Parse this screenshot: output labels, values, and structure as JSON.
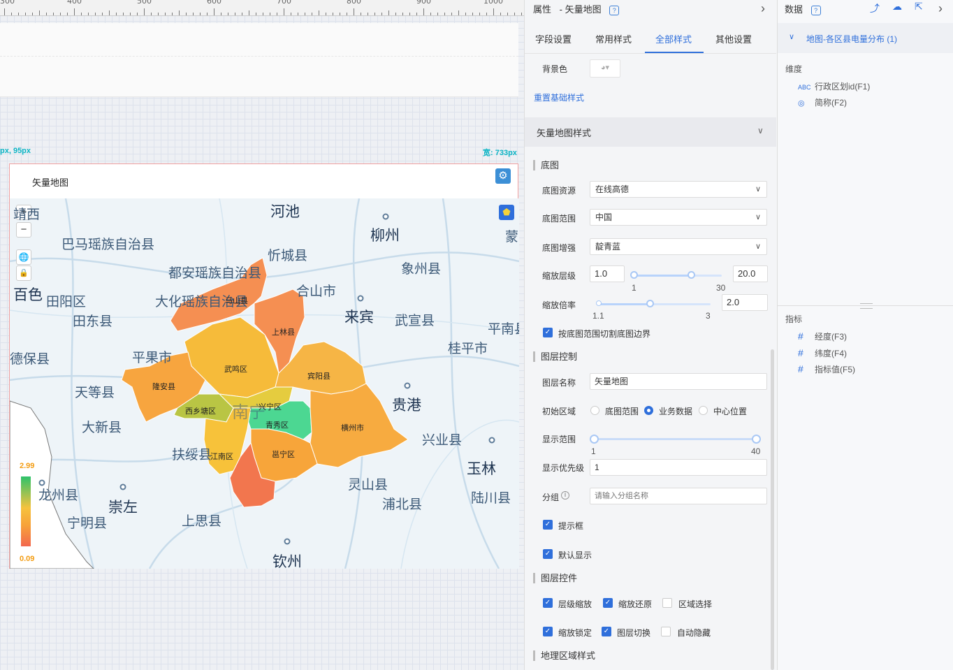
{
  "ruler": {
    "labels": [
      "300",
      "400",
      "500",
      "600",
      "700",
      "800",
      "900",
      "1000"
    ]
  },
  "guides": {
    "position": "px, 95px",
    "width": "宽: 733px"
  },
  "widget": {
    "title": "矢量地图",
    "zoom_in": "+",
    "zoom_out": "−",
    "cities": [
      "河池",
      "柳州",
      "巴马瑶族自治县",
      "忻城县",
      "象州县",
      "都安瑶族自治县",
      "百色",
      "田阳区",
      "大化瑶族自治县",
      "合山市",
      "来宾",
      "武宣县",
      "田东县",
      "平南县",
      "桂平市",
      "德保县",
      "平果市",
      "天等县",
      "贵港",
      "大新县",
      "扶绥县",
      "兴业县",
      "玉林",
      "龙州县",
      "崇左",
      "灵山县",
      "宁明县",
      "上思县",
      "浦北县",
      "陆川县",
      "钦州",
      "南宁",
      "蒙",
      "靖西"
    ],
    "regions": [
      "马山县",
      "上林县",
      "武鸣区",
      "宾阳县",
      "隆安县",
      "西乡塘区",
      "兴宁区",
      "青秀区",
      "横州市",
      "江南区",
      "邕宁区"
    ],
    "legend": {
      "max": "2.99",
      "min": "0.09"
    },
    "colors": {
      "high": "#2ec26b",
      "mid": "#f6c23e",
      "low": "#f2674e"
    }
  },
  "props": {
    "title": "属性",
    "subtitle": "- 矢量地图",
    "tabs": [
      "字段设置",
      "常用样式",
      "全部样式",
      "其他设置"
    ],
    "active_tab": "全部样式",
    "bg_label": "背景色",
    "reset_link": "重置基础样式",
    "section_title": "矢量地图样式",
    "basemap": "底图",
    "basemap_source_label": "底图资源",
    "basemap_source": "在线高德",
    "basemap_range_label": "底图范围",
    "basemap_range": "中国",
    "basemap_enhance_label": "底图增强",
    "basemap_enhance": "靛青蓝",
    "zoom_level_label": "缩放层级",
    "zoom_min": "1.0",
    "zoom_max": "20.0",
    "zoom_tick_min": "1",
    "zoom_tick_max": "30",
    "zoom_ratio_label": "缩放倍率",
    "zoom_ratio": "2.0",
    "ratio_tick_min": "1.1",
    "ratio_tick_max": "3",
    "clip_label": "按底图范围切割底图边界",
    "layer_control": "图层控制",
    "layer_name_label": "图层名称",
    "layer_name": "矢量地图",
    "init_area_label": "初始区域",
    "init_options": [
      "底图范围",
      "业务数据",
      "中心位置"
    ],
    "display_range_label": "显示范围",
    "display_min": "1",
    "display_max": "40",
    "priority_label": "显示优先级",
    "priority": "1",
    "group_label": "分组",
    "group_placeholder": "请输入分组名称",
    "tooltip_label": "提示框",
    "default_show_label": "默认显示",
    "layer_widgets": "图层控件",
    "widgets": [
      "层级缩放",
      "缩放还原",
      "区域选择",
      "缩放锁定",
      "图层切换",
      "自动隐藏"
    ],
    "geo_style": "地理区域样式"
  },
  "data": {
    "title": "数据",
    "dataset": "地图-各区县电量分布 (1)",
    "dimension_title": "维度",
    "dimensions": [
      "行政区划id(F1)",
      "简称(F2)"
    ],
    "dim_icons": [
      "ABC",
      "globe-icon"
    ],
    "measure_title": "指标",
    "measures": [
      "经度(F3)",
      "纬度(F4)",
      "指标值(F5)"
    ]
  }
}
